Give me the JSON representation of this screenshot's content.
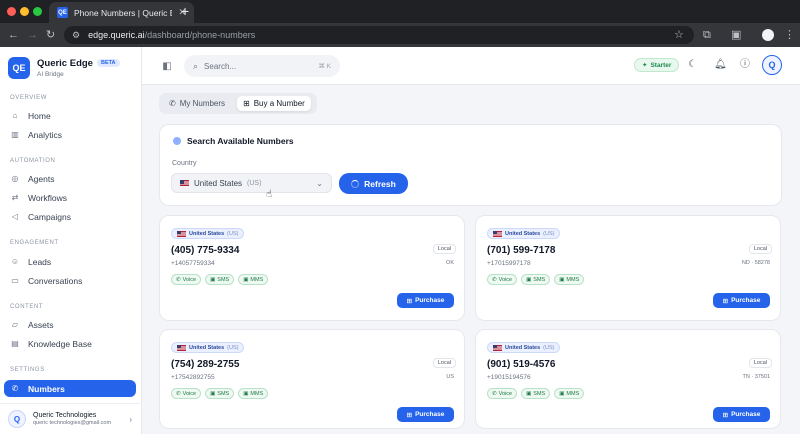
{
  "browser": {
    "tab_title": "Phone Numbers | Queric Edge",
    "tab_favicon": "QE",
    "url_domain": "edge.queric.ai",
    "url_path": "/dashboard/phone-numbers"
  },
  "brand": {
    "name": "Queric Edge",
    "badge": "BETA",
    "subtitle": "AI Bridge",
    "logo": "QE"
  },
  "sidebar": {
    "sections": [
      {
        "title": "OVERVIEW",
        "items": [
          {
            "label": "Home",
            "icon": "home-icon"
          },
          {
            "label": "Analytics",
            "icon": "chart-icon"
          }
        ]
      },
      {
        "title": "AUTOMATION",
        "items": [
          {
            "label": "Agents",
            "icon": "agents-icon"
          },
          {
            "label": "Workflows",
            "icon": "workflow-icon"
          },
          {
            "label": "Campaigns",
            "icon": "megaphone-icon"
          }
        ]
      },
      {
        "title": "ENGAGEMENT",
        "items": [
          {
            "label": "Leads",
            "icon": "users-icon"
          },
          {
            "label": "Conversations",
            "icon": "chat-icon"
          }
        ]
      },
      {
        "title": "CONTENT",
        "items": [
          {
            "label": "Assets",
            "icon": "folder-icon"
          },
          {
            "label": "Knowledge Base",
            "icon": "book-icon"
          }
        ]
      },
      {
        "title": "SETTINGS",
        "items": [
          {
            "label": "Numbers",
            "icon": "phone-icon",
            "active": true
          }
        ]
      }
    ],
    "user": {
      "name": "Queric Technologies",
      "email": "queric technologies@gmail.com",
      "initial": "Q"
    }
  },
  "header": {
    "search_placeholder": "Search...",
    "search_shortcut": "⌘ K",
    "plan_label": "Starter",
    "avatar_initial": "Q"
  },
  "tabs": [
    {
      "label": "My Numbers",
      "active": false
    },
    {
      "label": "Buy a Number",
      "active": true
    }
  ],
  "search_panel": {
    "title": "Search Available Numbers",
    "country_label": "Country",
    "country_value": "United States",
    "country_code": "(US)",
    "refresh_label": "Refresh"
  },
  "numbers": [
    {
      "country": "United States",
      "code": "(US)",
      "phone": "(405) 775-9334",
      "e164": "+14057759334",
      "type": "Local",
      "region": "OK",
      "caps": [
        "Voice",
        "SMS",
        "MMS"
      ],
      "purchase": "Purchase"
    },
    {
      "country": "United States",
      "code": "(US)",
      "phone": "(701) 599-7178",
      "e164": "+17015997178",
      "type": "Local",
      "region": "ND · 58278",
      "caps": [
        "Voice",
        "SMS",
        "MMS"
      ],
      "purchase": "Purchase"
    },
    {
      "country": "United States",
      "code": "(US)",
      "phone": "(754) 289-2755",
      "e164": "+17542892755",
      "type": "Local",
      "region": "US",
      "caps": [
        "Voice",
        "SMS",
        "MMS"
      ],
      "purchase": "Purchase"
    },
    {
      "country": "United States",
      "code": "(US)",
      "phone": "(901) 519-4576",
      "e164": "+19015194576",
      "type": "Local",
      "region": "TN · 37501",
      "caps": [
        "Voice",
        "SMS",
        "MMS"
      ],
      "purchase": "Purchase"
    }
  ],
  "colors": {
    "accent": "#2563eb",
    "success": "#1f8a4c"
  }
}
